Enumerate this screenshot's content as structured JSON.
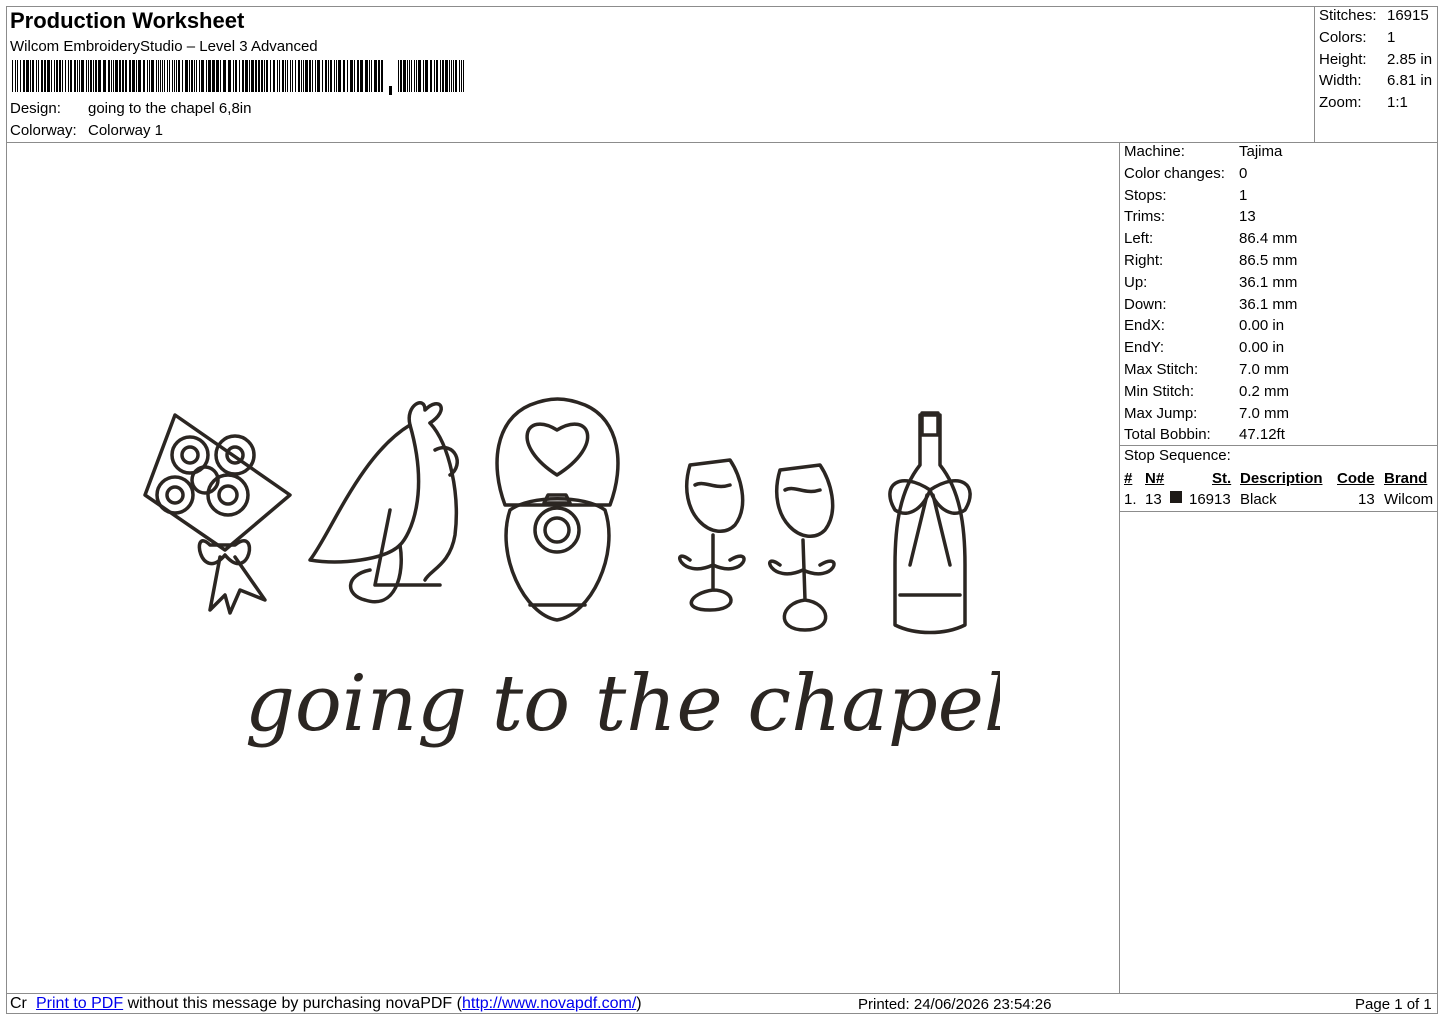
{
  "header": {
    "title": "Production Worksheet",
    "subtitle": "Wilcom EmbroideryStudio – Level 3 Advanced",
    "design_label": "Design:",
    "design_value": "going to the chapel 6,8in",
    "colorway_label": "Colorway:",
    "colorway_value": "Colorway 1"
  },
  "stats": [
    {
      "k": "Stitches:",
      "v": "16915"
    },
    {
      "k": "Colors:",
      "v": "1"
    },
    {
      "k": "Height:",
      "v": "2.85 in"
    },
    {
      "k": "Width:",
      "v": "6.81 in"
    },
    {
      "k": "Zoom:",
      "v": "1:1"
    }
  ],
  "params": [
    {
      "k": "Machine:",
      "v": "Tajima"
    },
    {
      "k": "Color changes:",
      "v": "0"
    },
    {
      "k": "Stops:",
      "v": "1"
    },
    {
      "k": "Trims:",
      "v": "13"
    },
    {
      "k": "Left:",
      "v": "86.4 mm"
    },
    {
      "k": "Right:",
      "v": "86.5 mm"
    },
    {
      "k": "Up:",
      "v": "36.1 mm"
    },
    {
      "k": "Down:",
      "v": "36.1 mm"
    },
    {
      "k": "EndX:",
      "v": "0.00 in"
    },
    {
      "k": "EndY:",
      "v": "0.00 in"
    },
    {
      "k": "Max Stitch:",
      "v": "7.0 mm"
    },
    {
      "k": "Min Stitch:",
      "v": "0.2 mm"
    },
    {
      "k": "Max Jump:",
      "v": "7.0 mm"
    },
    {
      "k": "Total Bobbin:",
      "v": "47.12ft"
    }
  ],
  "stop_sequence": {
    "title": "Stop Sequence:",
    "headers": {
      "num": "#",
      "n": "N#",
      "st": "St.",
      "desc": "Description",
      "code": "Code",
      "brand": "Brand"
    },
    "row": {
      "num": "1.",
      "n": "13",
      "st": "16913",
      "desc": "Black",
      "code": "13",
      "brand": "Wilcom",
      "color": "#1e1a17"
    }
  },
  "design_text": "going to the chapel",
  "thread_color": "#2b2622",
  "footer": {
    "prefix": "Cr",
    "link1": "Print to PDF",
    "middle": " without this message by purchasing novaPDF (",
    "link2": "http://www.novapdf.com/",
    "suffix": ")",
    "printed": "Printed: 24/06/2026 23:54:26",
    "page": "Page 1 of 1"
  }
}
